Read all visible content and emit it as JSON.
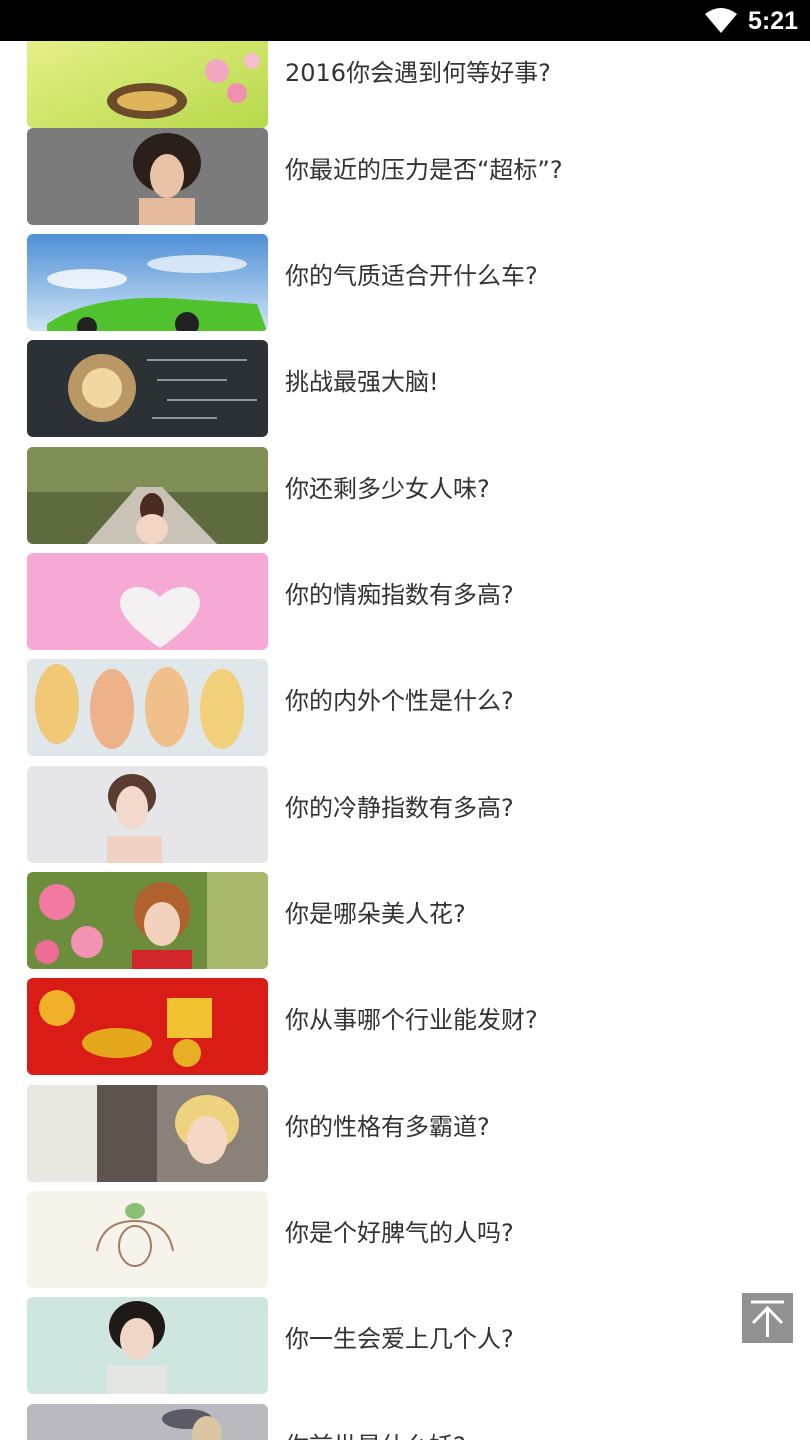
{
  "status_bar": {
    "time": "5:21",
    "wifi_icon": "wifi-icon"
  },
  "quiz_list": [
    {
      "title": "2016你会遇到何等好事?",
      "thumb": "butterfly"
    },
    {
      "title": "你最近的压力是否“超标”?",
      "thumb": "woman-hair"
    },
    {
      "title": "你的气质适合开什么车?",
      "thumb": "green-car-sky"
    },
    {
      "title": "挑战最强大脑!",
      "thumb": "lightbulb-chalkboard"
    },
    {
      "title": "你还剩多少女人味?",
      "thumb": "woman-tree-road"
    },
    {
      "title": "你的情痴指数有多高?",
      "thumb": "pink-heart"
    },
    {
      "title": "你的内外个性是什么?",
      "thumb": "braided-hair-illustration"
    },
    {
      "title": "你的冷静指数有多高?",
      "thumb": "woman-portrait"
    },
    {
      "title": "你是哪朵美人花?",
      "thumb": "woman-flowers"
    },
    {
      "title": "你从事哪个行业能发财?",
      "thumb": "golden-ox-red"
    },
    {
      "title": "你的性格有多霸道?",
      "thumb": "blond-boy-room"
    },
    {
      "title": "你是个好脾气的人吗?",
      "thumb": "girl-sketch"
    },
    {
      "title": "你一生会爱上几个人?",
      "thumb": "woman-short-hair"
    },
    {
      "title": "你前世是什么妖?",
      "thumb": "fantasy-figure"
    }
  ],
  "back_to_top": {
    "icon": "arrow-to-top-icon"
  }
}
